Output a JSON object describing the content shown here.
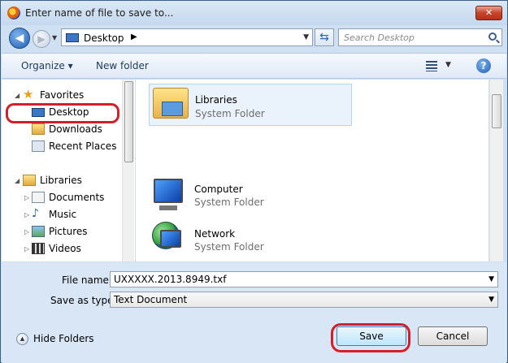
{
  "window": {
    "title": "Enter name of file to save to..."
  },
  "title_bar": {
    "close_label": "✕"
  },
  "nav": {
    "address": "Desktop",
    "search_placeholder": "Search Desktop"
  },
  "commands": {
    "organize": "Organize ▾",
    "new_folder": "New folder"
  },
  "sidebar": {
    "favorites_label": "Favorites",
    "items": [
      {
        "label": "Desktop",
        "icon": "desktop-icon"
      },
      {
        "label": "Downloads",
        "icon": "downloads-folder-icon"
      },
      {
        "label": "Recent Places",
        "icon": "recent-places-icon"
      }
    ],
    "libraries_label": "Libraries",
    "libraries": [
      {
        "label": "Documents",
        "icon": "documents-library-icon"
      },
      {
        "label": "Music",
        "icon": "music-library-icon"
      },
      {
        "label": "Pictures",
        "icon": "pictures-library-icon"
      },
      {
        "label": "Videos",
        "icon": "videos-library-icon"
      }
    ]
  },
  "content": {
    "items": [
      {
        "title": "Libraries",
        "subtitle": "System Folder",
        "icon": "libraries-folder-icon"
      },
      {
        "title": "Computer",
        "subtitle": "System Folder",
        "icon": "computer-icon"
      },
      {
        "title": "Network",
        "subtitle": "System Folder",
        "icon": "network-icon"
      }
    ]
  },
  "form": {
    "file_name_label": "File name:",
    "file_name_value": "UXXXXX.2013.8949.txf",
    "save_type_label": "Save as type:",
    "save_type_value": "Text Document"
  },
  "footer": {
    "hide_folders": "Hide Folders",
    "save": "Save",
    "cancel": "Cancel"
  },
  "colors": {
    "highlight_ring": "#d21f2a",
    "title_bg": "#c4d8ee"
  }
}
